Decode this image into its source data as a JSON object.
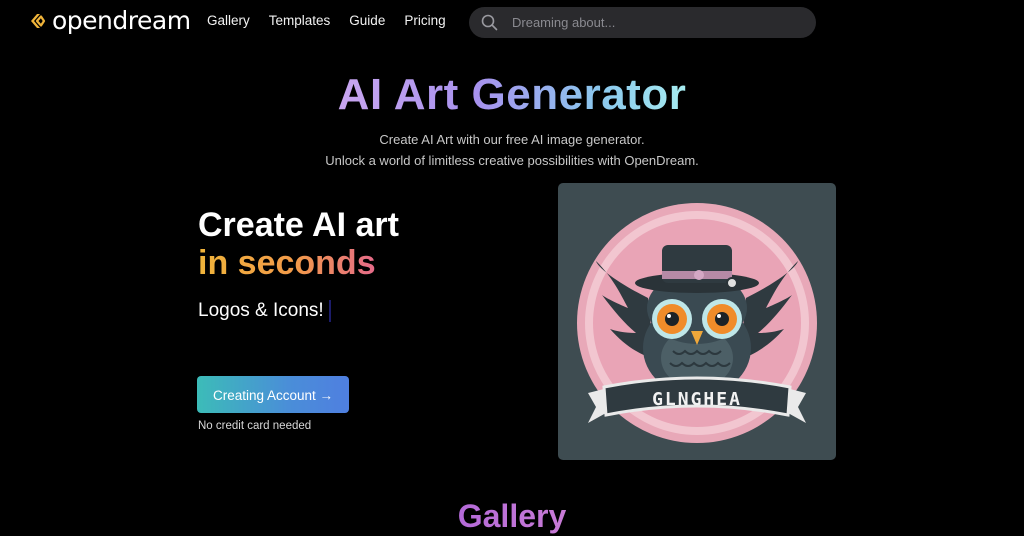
{
  "brand": {
    "name": "opendream",
    "accent": "#f0b43a"
  },
  "nav": {
    "links": [
      {
        "label": "Gallery"
      },
      {
        "label": "Templates"
      },
      {
        "label": "Guide"
      },
      {
        "label": "Pricing"
      }
    ]
  },
  "search": {
    "placeholder": "Dreaming about...",
    "value": "",
    "icon": "search-icon"
  },
  "hero": {
    "title": "AI Art Generator",
    "subtitle_line1": "Create AI Art with our free AI image generator.",
    "subtitle_line2": "Unlock a world of limitless creative possibilities with OpenDream."
  },
  "promo": {
    "headline1": "Create AI art",
    "headline2": "in seconds",
    "typed_text": "Logos & Icons!",
    "cta_label": "Creating Account →",
    "note": "No credit card needed"
  },
  "art": {
    "banner_text": "GLNGHEA"
  },
  "gallery": {
    "title": "Gallery"
  },
  "colors": {
    "background": "#000000",
    "search_bg": "#2a2a2d",
    "card_bg": "#3e4c51",
    "cta_start": "#3cbcb8",
    "cta_end": "#4f7fe0"
  }
}
